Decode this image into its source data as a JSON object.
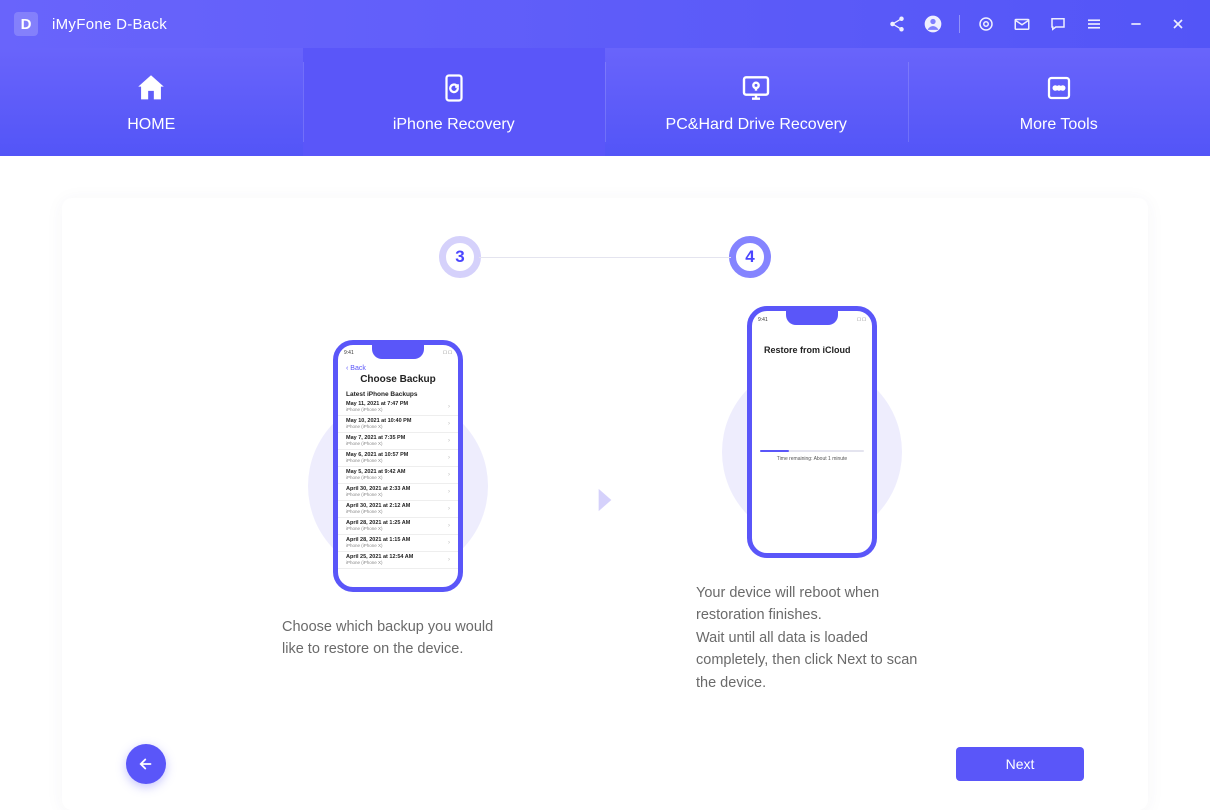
{
  "app": {
    "name": "iMyFone D-Back",
    "logo_letter": "D"
  },
  "titlebar_icons": [
    "share",
    "account",
    "badge",
    "mail",
    "message",
    "menu",
    "minimize",
    "close"
  ],
  "tabs": [
    {
      "id": "home",
      "label": "HOME",
      "selected": false
    },
    {
      "id": "iphone",
      "label": "iPhone Recovery",
      "selected": true
    },
    {
      "id": "pc",
      "label": "PC&Hard Drive Recovery",
      "selected": false
    },
    {
      "id": "more",
      "label": "More Tools",
      "selected": false
    }
  ],
  "steps": {
    "left": "3",
    "right": "4"
  },
  "phone1": {
    "back": "Back",
    "title": "Choose Backup",
    "subtitle": "Latest iPhone Backups",
    "items": [
      {
        "main": "May 11, 2021 at 7:47 PM",
        "sub": "iPhone (iPhone X)"
      },
      {
        "main": "May 10, 2021 at 10:40 PM",
        "sub": "iPhone (iPhone X)"
      },
      {
        "main": "May 7, 2021 at 7:35 PM",
        "sub": "iPhone (iPhone X)"
      },
      {
        "main": "May 6, 2021 at 10:57 PM",
        "sub": "iPhone (iPhone X)"
      },
      {
        "main": "May 5, 2021 at 9:42 AM",
        "sub": "iPhone (iPhone X)"
      },
      {
        "main": "April 30, 2021 at 2:33 AM",
        "sub": "iPhone (iPhone X)"
      },
      {
        "main": "April 30, 2021 at 2:12 AM",
        "sub": "iPhone (iPhone X)"
      },
      {
        "main": "April 28, 2021 at 1:25 AM",
        "sub": "iPhone (iPhone X)"
      },
      {
        "main": "April 28, 2021 at 1:15 AM",
        "sub": "iPhone (iPhone X)"
      },
      {
        "main": "April 25, 2021 at 12:54 AM",
        "sub": "iPhone (iPhone X)"
      }
    ]
  },
  "phone2": {
    "title": "Restore from iCloud",
    "remaining": "Time remaining: About 1 minute"
  },
  "desc": {
    "left": "Choose which backup you would like to restore on the device.",
    "right": "Your device will reboot when restoration finishes.\nWait until all data is loaded completely, then click Next to scan the device."
  },
  "buttons": {
    "next": "Next"
  }
}
